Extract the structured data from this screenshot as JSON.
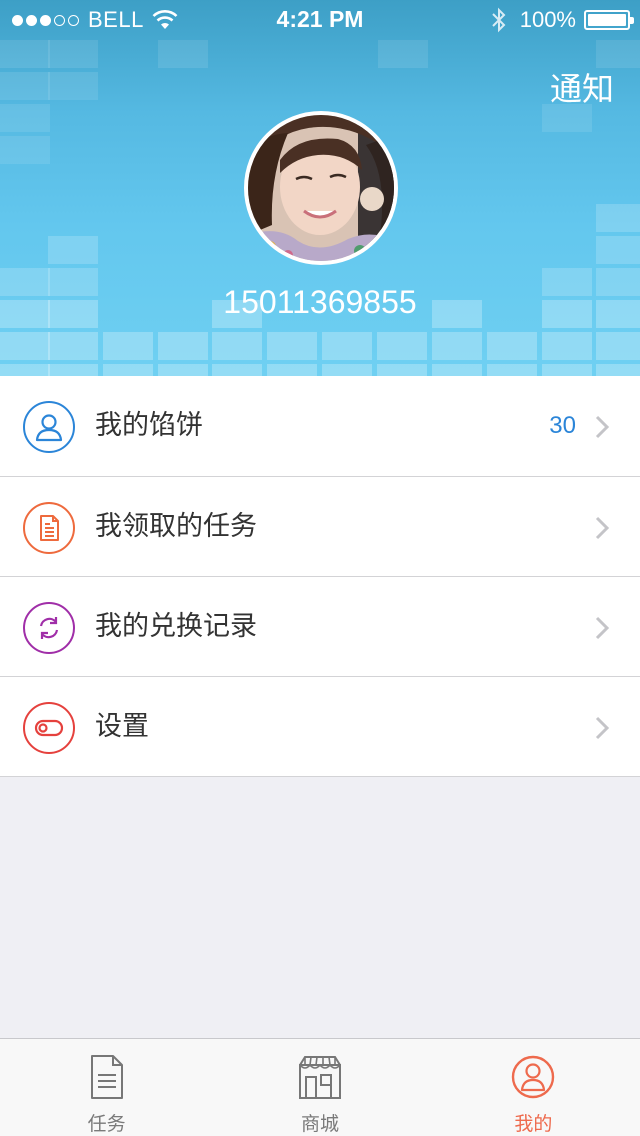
{
  "status_bar": {
    "carrier": "BELL",
    "time": "4:21 PM",
    "battery": "100%"
  },
  "header": {
    "notify_label": "通知",
    "phone": "15011369855"
  },
  "menu": {
    "items": [
      {
        "label": "我的馅饼",
        "value": "30",
        "icon": "user-icon",
        "color": "#2b85d8"
      },
      {
        "label": "我领取的任务",
        "value": "",
        "icon": "document-icon",
        "color": "#ee6a3d"
      },
      {
        "label": "我的兑换记录",
        "value": "",
        "icon": "refresh-icon",
        "color": "#a02ea8"
      },
      {
        "label": "设置",
        "value": "",
        "icon": "toggle-icon",
        "color": "#e5413d"
      }
    ]
  },
  "tabs": [
    {
      "label": "任务",
      "icon": "document-icon",
      "active": false
    },
    {
      "label": "商城",
      "icon": "store-icon",
      "active": false
    },
    {
      "label": "我的",
      "icon": "user-icon",
      "active": true
    }
  ],
  "colors": {
    "header_top": "#3d9fc6",
    "header_bottom": "#6fd0f2",
    "accent_active": "#ee6a4d",
    "value_blue": "#2b85d8"
  }
}
